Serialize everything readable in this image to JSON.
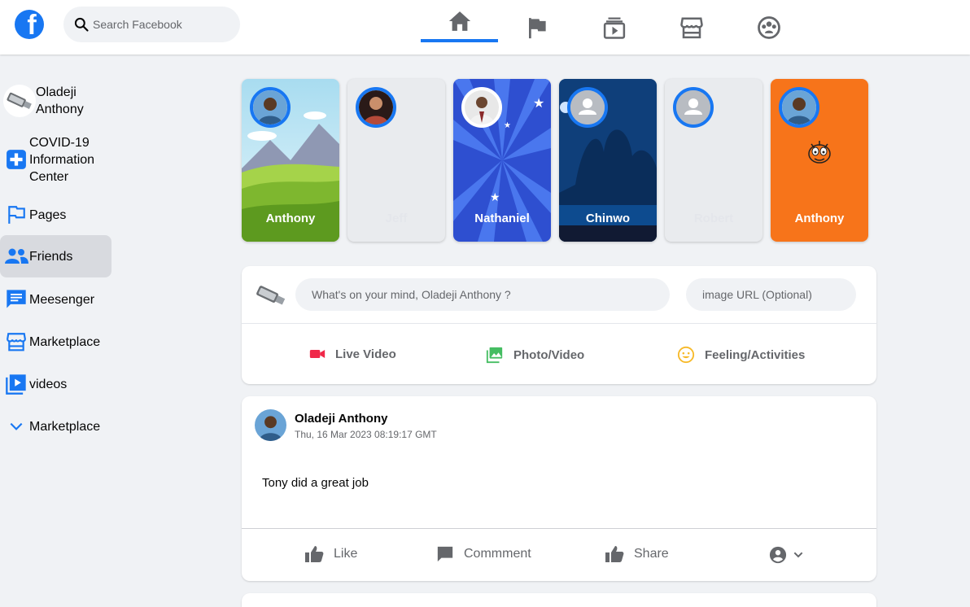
{
  "header": {
    "logo_letter": "f",
    "search_placeholder": "Search Facebook",
    "nav_tabs": [
      "home-icon",
      "flag-icon",
      "watch-icon",
      "marketplace-icon",
      "groups-icon"
    ],
    "active_tab": "home-icon"
  },
  "sidebar": {
    "items": [
      {
        "label": "Oladeji Anthony",
        "icon": "profile-avatar"
      },
      {
        "label": "COVID-19 Information Center",
        "icon": "medical-plus-icon"
      },
      {
        "label": "Pages",
        "icon": "flag-icon"
      },
      {
        "label": "Friends",
        "icon": "friends-icon",
        "active": true
      },
      {
        "label": "Meesenger",
        "icon": "message-icon"
      },
      {
        "label": "Marketplace",
        "icon": "store-icon"
      },
      {
        "label": "videos",
        "icon": "video-icon"
      },
      {
        "label": "Marketplace",
        "icon": "chevron-down-icon"
      }
    ]
  },
  "stories": [
    {
      "name": "Anthony",
      "background": "landscape"
    },
    {
      "name": "Jeff",
      "background": "blank"
    },
    {
      "name": "Nathaniel",
      "background": "blue-burst"
    },
    {
      "name": "Chinwo",
      "background": "night-forest"
    },
    {
      "name": "Robert",
      "background": "blank"
    },
    {
      "name": "Anthony",
      "background": "orange"
    }
  ],
  "composer": {
    "status_placeholder": "What's on your mind, Oladeji Anthony ?",
    "image_placeholder": "image URL (Optional)",
    "actions": [
      {
        "label": "Live Video",
        "icon": "video-camera-icon",
        "color": "#f02849"
      },
      {
        "label": "Photo/Video",
        "icon": "photo-icon",
        "color": "#45bd62"
      },
      {
        "label": "Feeling/Activities",
        "icon": "smiley-icon",
        "color": "#f7b928"
      }
    ]
  },
  "post": {
    "author": "Oladeji Anthony",
    "timestamp": "Thu, 16 Mar 2023 08:19:17 GMT",
    "text": "Tony did a great job",
    "actions": {
      "like": "Like",
      "comment": "Commment",
      "share": "Share"
    }
  },
  "colors": {
    "brand": "#1877f2",
    "background": "#f0f2f5",
    "muted_text": "#65676b"
  }
}
